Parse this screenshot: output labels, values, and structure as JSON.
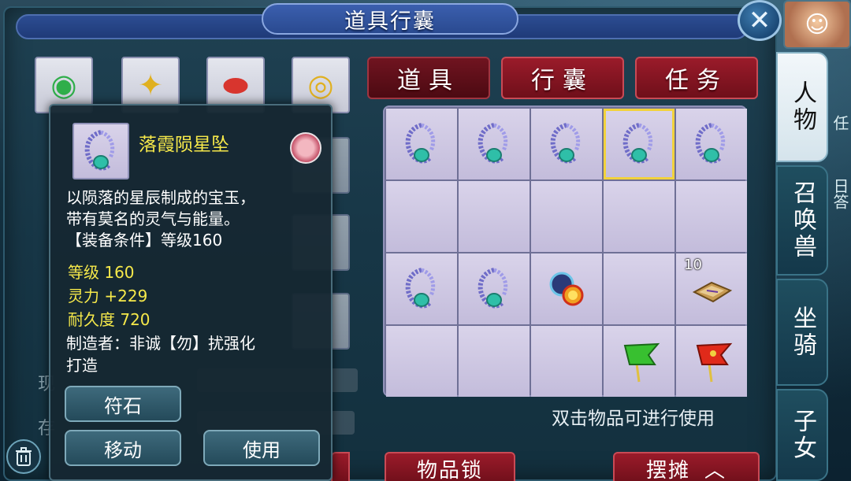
{
  "window": {
    "title": "道具行囊",
    "close_icon": "close-icon"
  },
  "side_tabs": [
    {
      "label": "人物",
      "active": true
    },
    {
      "label": "召唤兽",
      "active": false
    },
    {
      "label": "坐骑",
      "active": false
    },
    {
      "label": "子女",
      "active": false
    }
  ],
  "category_tabs": [
    {
      "label": "道具",
      "active": true
    },
    {
      "label": "行囊",
      "active": false
    },
    {
      "label": "任务",
      "active": false
    }
  ],
  "equipment_slots": [
    {
      "icon": "green-orb-amulet-icon"
    },
    {
      "icon": "gold-charm-icon"
    },
    {
      "icon": "red-gem-icon"
    },
    {
      "icon": "gold-bracelet-icon"
    }
  ],
  "inventory": {
    "cells": [
      {
        "icon": "star-pendant-icon"
      },
      {
        "icon": "star-pendant-icon"
      },
      {
        "icon": "star-pendant-icon"
      },
      {
        "icon": "star-pendant-icon",
        "selected": true
      },
      {
        "icon": "star-pendant-icon"
      },
      {},
      {},
      {},
      {},
      {},
      {
        "icon": "star-pendant-icon"
      },
      {
        "icon": "star-pendant-icon"
      },
      {
        "icon": "sun-moon-disc-icon"
      },
      {},
      {
        "icon": "scroll-book-icon",
        "qty": "10"
      },
      {},
      {},
      {},
      {
        "icon": "green-flag-icon"
      },
      {
        "icon": "red-flag-icon"
      }
    ],
    "hint": "双击物品可进行使用"
  },
  "bottom_buttons": {
    "lock": "物品锁",
    "stall": "摆摊"
  },
  "tooltip": {
    "item_name": "落霞陨星坠",
    "description_lines": [
      "以陨落的星辰制成的宝玉，",
      "带有莫名的灵气与能量。",
      "【装备条件】等级160"
    ],
    "stats": [
      "等级 160",
      "灵力 +229",
      "耐久度 720"
    ],
    "maker_lines": [
      "制造者：非诚【勿】扰强化",
      "打造"
    ],
    "buttons": {
      "rune": "符石",
      "move": "移动",
      "use": "使用"
    }
  },
  "colors": {
    "accent_yellow": "#f6e94a",
    "tab_red": "#9a1b2a",
    "grid_cell": "#d9d3ea"
  }
}
